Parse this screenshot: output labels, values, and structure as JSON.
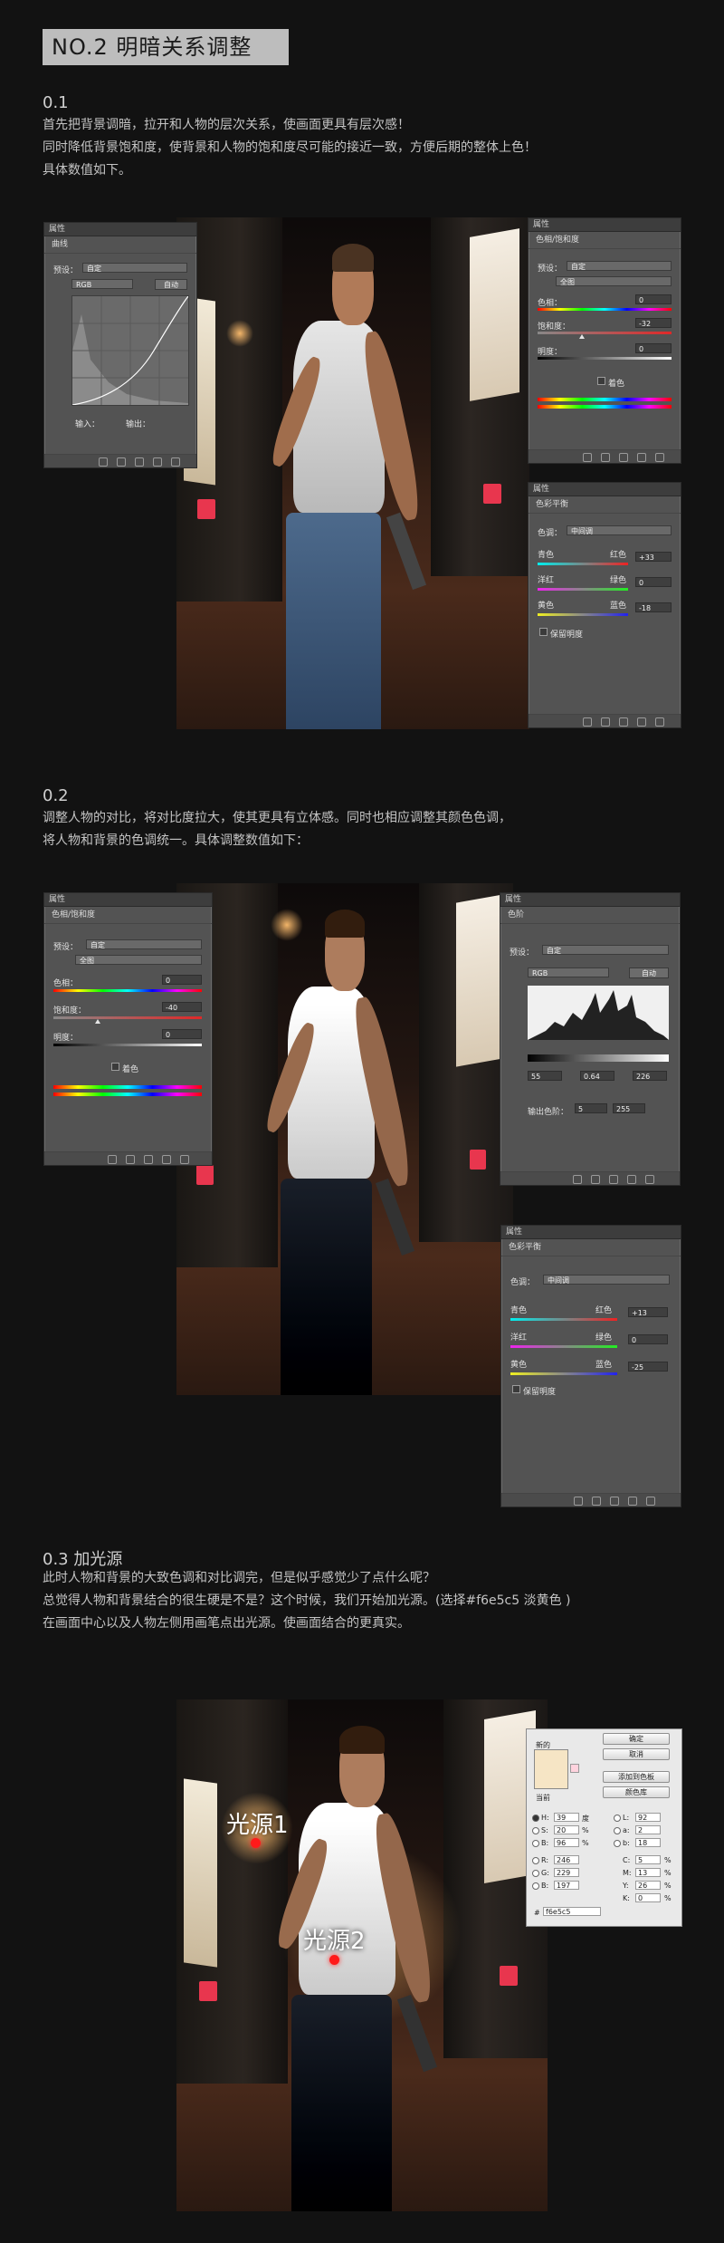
{
  "page_title": "NO.2 明暗关系调整",
  "sections": [
    {
      "num": "0.1",
      "lines": [
        "首先把背景调暗，拉开和人物的层次关系，使画面更具有层次感！",
        "同时降低背景饱和度，使背景和人物的饱和度尽可能的接近一致，方便后期的整体上色！",
        "具体数值如下。"
      ]
    },
    {
      "num": "0.2",
      "lines": [
        "调整人物的对比，将对比度拉大，使其更具有立体感。同时也相应调整其颜色色调，",
        "将人物和背景的色调统一。具体调整数值如下："
      ]
    },
    {
      "num": "0.3 加光源",
      "lines": [
        "此时人物和背景的大致色调和对比调完，但是似乎感觉少了点什么呢？",
        "总觉得人物和背景结合的很生硬是不是？这个时候，我们开始加光源。(选择#f6e5c5 淡黄色 )",
        "在画面中心以及人物左侧用画笔点出光源。使画面结合的更真实。"
      ]
    }
  ],
  "panels": {
    "tab": "属性",
    "curves": {
      "title": "曲线",
      "preset_label": "预设：",
      "preset_value": "自定",
      "channel": "RGB",
      "auto_btn": "自动",
      "input_label": "输入：",
      "output_label": "输出："
    },
    "hsl1": {
      "title": "色相/饱和度",
      "preset_label": "预设：",
      "preset_value": "自定",
      "range": "全图",
      "hue_label": "色相：",
      "hue": "0",
      "sat_label": "饱和度：",
      "sat": "-32",
      "light_label": "明度：",
      "light": "0",
      "colorize": "着色"
    },
    "cb1": {
      "title": "色彩平衡",
      "tone_label": "色调：",
      "tone": "中间调",
      "cyan": "青色",
      "red": "红色",
      "v1": "+33",
      "magenta": "洋红",
      "green": "绿色",
      "v2": "0",
      "yellow": "黄色",
      "blue": "蓝色",
      "v3": "-18",
      "preserve": "保留明度"
    },
    "hsl2": {
      "title": "色相/饱和度",
      "preset_label": "预设：",
      "preset_value": "自定",
      "range": "全图",
      "hue_label": "色相：",
      "hue": "0",
      "sat_label": "饱和度：",
      "sat": "-40",
      "light_label": "明度：",
      "light": "0",
      "colorize": "着色"
    },
    "levels": {
      "title": "色阶",
      "preset_label": "预设：",
      "preset_value": "自定",
      "channel": "RGB",
      "auto_btn": "自动",
      "in_black": "55",
      "in_gamma": "0.64",
      "in_white": "226",
      "output_label": "输出色阶：",
      "out_black": "5",
      "out_white": "255"
    },
    "cb2": {
      "title": "色彩平衡",
      "tone_label": "色调：",
      "tone": "中间调",
      "cyan": "青色",
      "red": "红色",
      "v1": "+13",
      "magenta": "洋红",
      "green": "绿色",
      "v2": "0",
      "yellow": "黄色",
      "blue": "蓝色",
      "v3": "-25",
      "preserve": "保留明度"
    }
  },
  "color_picker": {
    "new_label": "新的",
    "current_label": "当前",
    "swatch": "#f6e5c5",
    "buttons": [
      "确定",
      "取消",
      "添加到色板",
      "颜色库"
    ],
    "fields": {
      "H": "39",
      "H_unit": "度",
      "S": "20",
      "S_unit": "%",
      "B": "96",
      "B_unit": "%",
      "R": "246",
      "G": "229",
      "Bv": "197",
      "L": "92",
      "a": "2",
      "b": "18",
      "C": "5",
      "M": "13",
      "Y": "26",
      "K": "0",
      "hex_label": "#",
      "hex": "f6e5c5"
    }
  },
  "light_labels": [
    "光源1",
    "光源2"
  ]
}
